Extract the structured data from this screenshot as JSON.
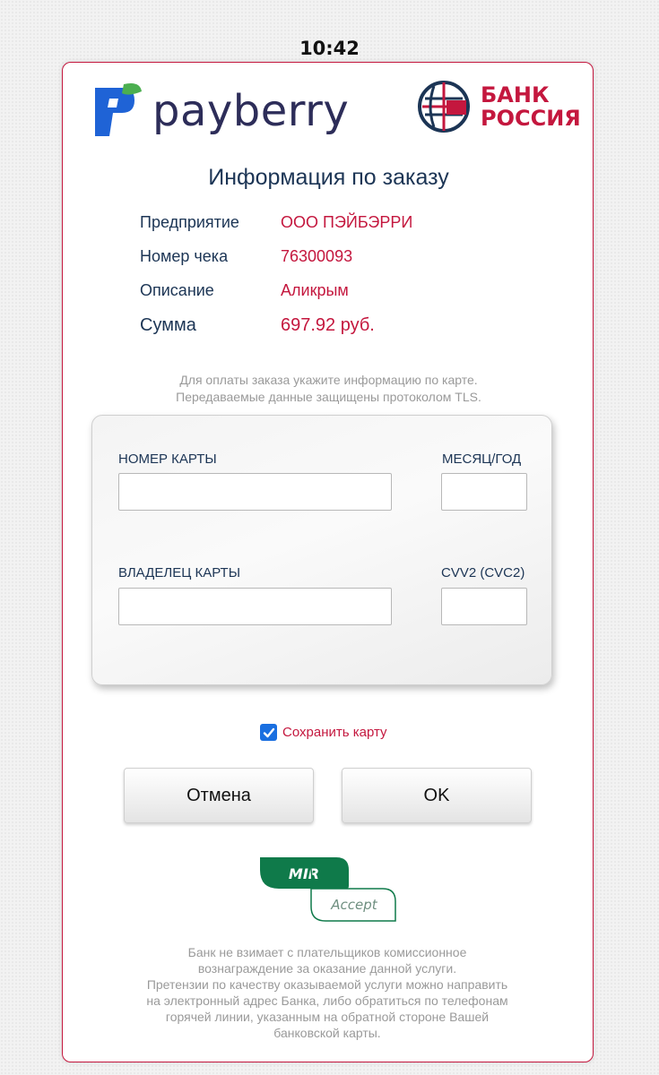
{
  "status_bar": {
    "time": "10:42"
  },
  "header": {
    "payberry_logo_text": "payberry",
    "bank_logo_line1": "БАНК",
    "bank_logo_line2": "РОССИЯ"
  },
  "order": {
    "title": "Информация по заказу",
    "rows": [
      {
        "label": "Предприятие",
        "value": "ООО ПЭЙБЭРРИ"
      },
      {
        "label": "Номер чека",
        "value": "76300093"
      },
      {
        "label": "Описание",
        "value": "Аликрым"
      },
      {
        "label": "Сумма",
        "value": "697.92 руб."
      }
    ]
  },
  "notice": {
    "line1": "Для оплаты заказа укажите информацию по карте.",
    "line2": "Передаваемые данные защищены протоколом TLS."
  },
  "card_form": {
    "card_number_label": "НОМЕР КАРТЫ",
    "card_number_value": "",
    "expiry_label": "МЕСЯЦ/ГОД",
    "expiry_value": "",
    "holder_label": "ВЛАДЕЛЕЦ КАРТЫ",
    "holder_value": "",
    "cvv_label": "CVV2 (CVC2)",
    "cvv_value": ""
  },
  "save_card": {
    "label": "Сохранить карту",
    "checked": true
  },
  "buttons": {
    "cancel": "Отмена",
    "ok": "OK"
  },
  "mir_accept": {
    "mir_text": "MIR",
    "accept_text": "Accept"
  },
  "colors": {
    "accent": "#c4173e",
    "text_dark": "#1c3555",
    "muted": "#9a9a9a",
    "checkbox": "#1a6fe0"
  },
  "footer": {
    "lines": [
      "Банк не взимает с плательщиков комиссионное",
      "вознаграждение за оказание данной услуги.",
      "Претензии по качеству оказываемой услуги можно направить",
      "на электронный адрес Банка, либо обратиться по телефонам",
      "горячей линии, указанным на обратной стороне Вашей",
      "банковской карты."
    ]
  }
}
